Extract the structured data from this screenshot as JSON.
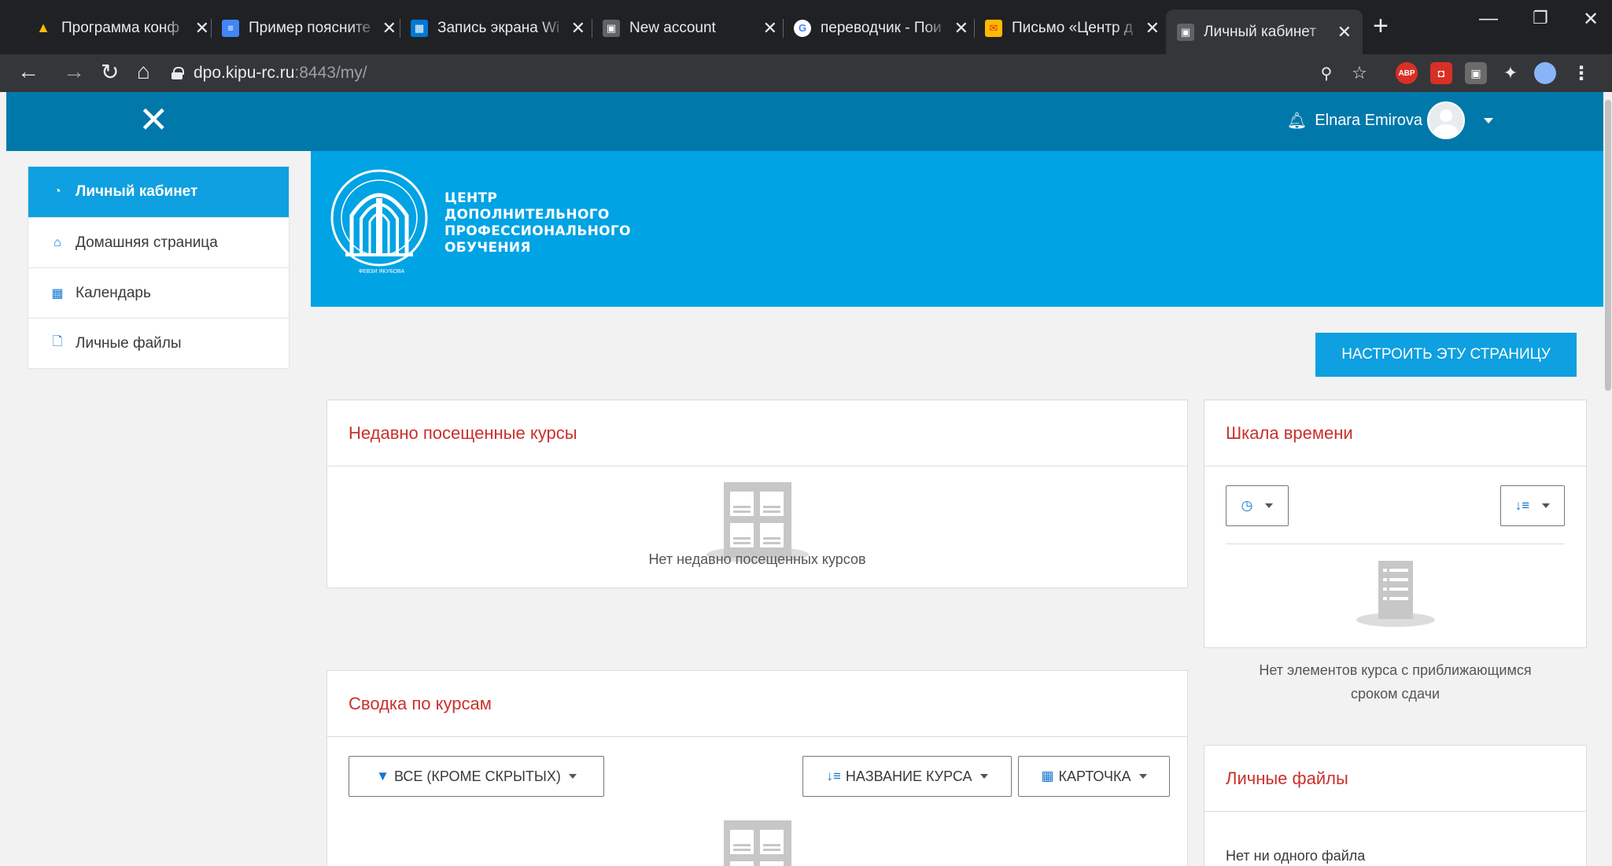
{
  "browser": {
    "tabs": [
      {
        "title": "Программа конф",
        "fav_color": "#fbbc04",
        "fav_glyph": "▲"
      },
      {
        "title": "Пример поясните",
        "fav_color": "#4285f4",
        "fav_glyph": "≡"
      },
      {
        "title": "Запись экрана Wi",
        "fav_color": "#0078d4",
        "fav_glyph": "▦"
      },
      {
        "title": "New account",
        "fav_color": "#5f6368",
        "fav_glyph": "▣"
      },
      {
        "title": "переводчик - Пои",
        "fav_color": "#ffffff",
        "fav_glyph": "G"
      },
      {
        "title": "Письмо «Центр д",
        "fav_color": "#ffb900",
        "fav_glyph": "✉"
      },
      {
        "title": "Личный кабинет",
        "fav_color": "#5f6368",
        "fav_glyph": "▣"
      }
    ],
    "url_host": "dpo.kipu-rc.ru",
    "url_rest": ":8443/my/"
  },
  "header": {
    "user_name": "Elnara Emirova"
  },
  "sidebar": {
    "items": [
      {
        "label": "Личный кабинет",
        "icon": "dashboard-icon"
      },
      {
        "label": "Домашняя страница",
        "icon": "home-icon"
      },
      {
        "label": "Календарь",
        "icon": "calendar-icon"
      },
      {
        "label": "Личные файлы",
        "icon": "file-icon"
      }
    ]
  },
  "banner": {
    "logo_lines": [
      "ЦЕНТР",
      "ДОПОЛНИТЕЛЬНОГО",
      "ПРОФЕССИОНАЛЬНОГО",
      "ОБУЧЕНИЯ"
    ],
    "logo_caption": "ФЕВЗИ ЯКУБОВА"
  },
  "main": {
    "customize_label": "НАСТРОИТЬ ЭТУ СТРАНИЦУ",
    "recent": {
      "title": "Недавно посещенные курсы",
      "empty": "Нет недавно посещенных курсов"
    },
    "overview": {
      "title": "Сводка по курсам",
      "filter_label": "ВСЕ (КРОМЕ СКРЫТЫХ)",
      "sort_label": "НАЗВАНИЕ КУРСА",
      "view_label": "КАРТОЧКА"
    },
    "timeline": {
      "title": "Шкала времени",
      "empty_line1": "Нет элементов курса с приближающимся",
      "empty_line2": "сроком сдачи"
    },
    "private_files": {
      "title": "Личные файлы",
      "empty": "Нет ни одного файла"
    }
  }
}
